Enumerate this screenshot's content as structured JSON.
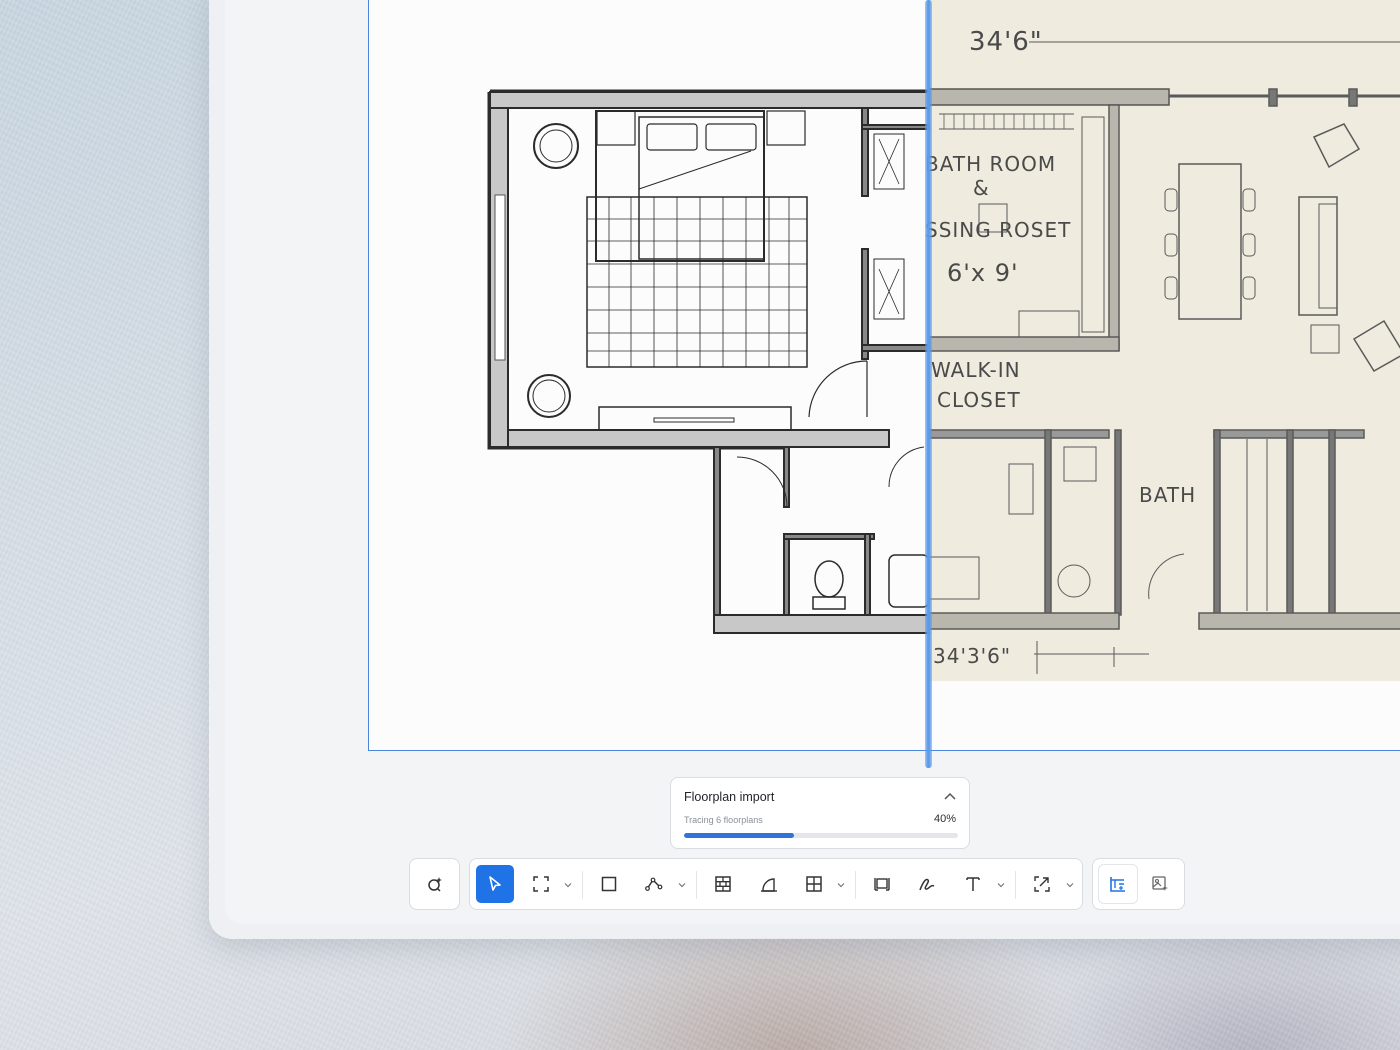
{
  "canvas": {
    "sketch_labels": {
      "top_dimension": "34'6\"",
      "bath_room": "BATH ROOM",
      "ampersand": "&",
      "dressing_closet": "SSING ROSET",
      "room_size": "6'x 9'",
      "walk_in": "WALK-IN",
      "closet": "CLOSET",
      "bath": "BATH",
      "bottom_dimension": "34'3'6\""
    }
  },
  "import_panel": {
    "title": "Floorplan import",
    "status": "Tracing 6 floorplans",
    "percent_label": "40%",
    "progress": 0.4
  },
  "toolbar": {
    "tools": [
      {
        "name": "ai-select-tool",
        "icon": "magic-search-icon"
      },
      {
        "name": "select-tool",
        "icon": "cursor-arrow-icon",
        "active": true
      },
      {
        "name": "frame-tool",
        "icon": "frame-corners-icon",
        "has_menu": true
      },
      {
        "name": "rectangle-tool",
        "icon": "square-icon"
      },
      {
        "name": "path-tool",
        "icon": "pen-nodes-icon",
        "has_menu": true
      },
      {
        "name": "wall-tool",
        "icon": "brick-wall-icon"
      },
      {
        "name": "door-tool",
        "icon": "door-arc-icon"
      },
      {
        "name": "window-tool",
        "icon": "window-grid-icon",
        "has_menu": true
      },
      {
        "name": "furniture-tool",
        "icon": "furniture-icon"
      },
      {
        "name": "draw-tool",
        "icon": "scribble-icon"
      },
      {
        "name": "text-tool",
        "icon": "text-t-icon",
        "has_menu": true
      },
      {
        "name": "scale-tool",
        "icon": "scale-arrows-icon",
        "has_menu": true
      },
      {
        "name": "floorplan-trace-tool",
        "icon": "floorplan-trace-icon",
        "selected": true
      },
      {
        "name": "image-ai-tool",
        "icon": "image-sparkle-icon"
      }
    ]
  },
  "colors": {
    "accent": "#1f73e6",
    "split_line": "#5b9be8",
    "sketch_paper": "#efebdf"
  }
}
